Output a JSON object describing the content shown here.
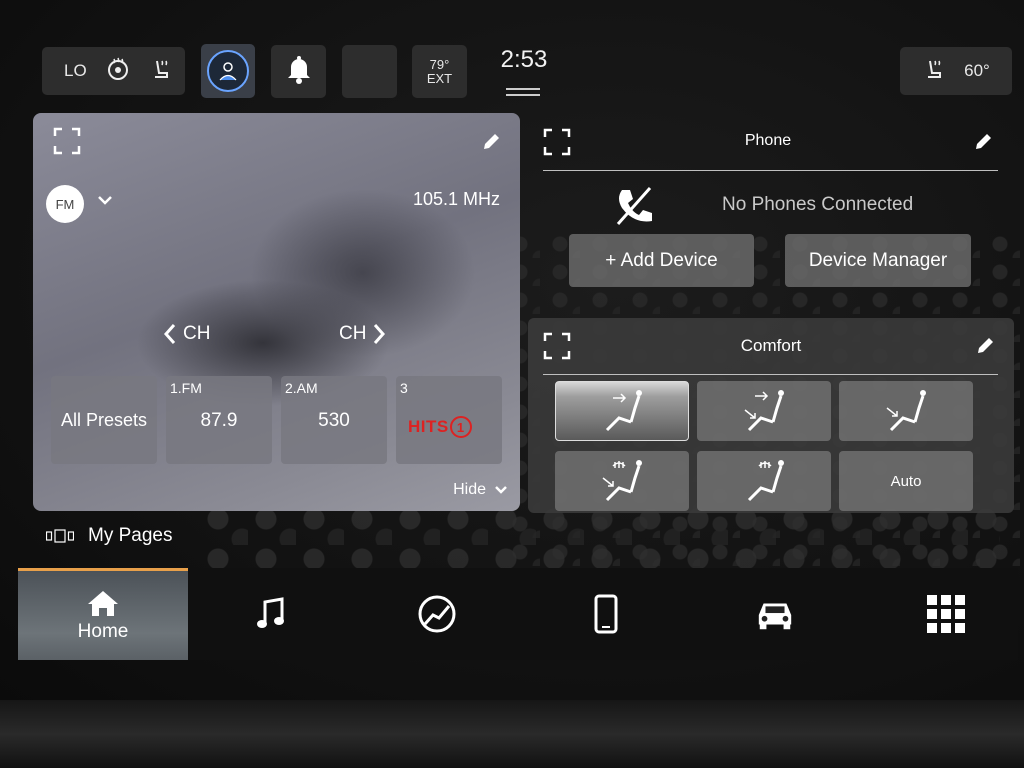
{
  "status_bar": {
    "fan_level": "LO",
    "temp_exterior": "79°",
    "temp_exterior_label": "EXT",
    "clock": "2:53",
    "seat_temp": "60°"
  },
  "radio": {
    "band": "FM",
    "frequency": "105.1 MHz",
    "ch_prev_label": "CH",
    "ch_next_label": "CH",
    "all_presets_label": "All Presets",
    "presets": [
      {
        "number": "1.FM",
        "value": "87.9"
      },
      {
        "number": "2.AM",
        "value": "530"
      },
      {
        "number": "3",
        "logo_text": "HITS",
        "logo_mark": "1"
      }
    ],
    "hide_label": "Hide"
  },
  "phone": {
    "title": "Phone",
    "status": "No Phones Connected",
    "add_device_label": "+ Add Device",
    "device_manager_label": "Device Manager"
  },
  "comfort": {
    "title": "Comfort",
    "auto_label": "Auto"
  },
  "my_pages_label": "My Pages",
  "nav": {
    "home_label": "Home",
    "items": [
      "home-icon",
      "music-icon",
      "controls-icon",
      "phone-icon",
      "vehicle-icon",
      "apps-grid-icon"
    ]
  },
  "colors": {
    "accent": "#e8a04a",
    "driver_ring": "#6aa4ff",
    "hits_red": "#dd2222"
  }
}
